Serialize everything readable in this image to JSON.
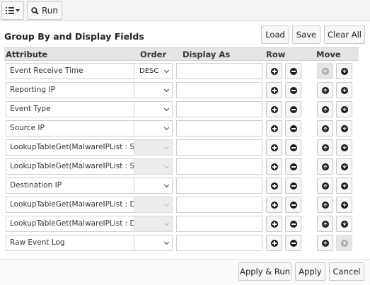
{
  "toolbar": {
    "menu_icon": "list-icon",
    "run_icon": "search-icon",
    "run_label": "Run"
  },
  "section": {
    "title": "Group By and Display Fields",
    "load_label": "Load",
    "save_label": "Save",
    "clear_all_label": "Clear All"
  },
  "table": {
    "headers": {
      "attribute": "Attribute",
      "order": "Order",
      "display_as": "Display As",
      "row": "Row",
      "move": "Move"
    },
    "rows": [
      {
        "attribute": "Event Receive Time",
        "order": "DESC",
        "order_enabled": true,
        "display_as": "",
        "move_up_enabled": false,
        "move_down_enabled": true
      },
      {
        "attribute": "Reporting IP",
        "order": "",
        "order_enabled": true,
        "display_as": "",
        "move_up_enabled": true,
        "move_down_enabled": true
      },
      {
        "attribute": "Event Type",
        "order": "",
        "order_enabled": true,
        "display_as": "",
        "move_up_enabled": true,
        "move_down_enabled": true
      },
      {
        "attribute": "Source IP",
        "order": "",
        "order_enabled": true,
        "display_as": "",
        "move_up_enabled": true,
        "move_down_enabled": true
      },
      {
        "attribute": "LookupTableGet(MalwareIPList : Sour",
        "order": "",
        "order_enabled": false,
        "display_as": "",
        "move_up_enabled": true,
        "move_down_enabled": true
      },
      {
        "attribute": "LookupTableGet(MalwareIPList : Sour",
        "order": "",
        "order_enabled": false,
        "display_as": "",
        "move_up_enabled": true,
        "move_down_enabled": true
      },
      {
        "attribute": "Destination IP",
        "order": "",
        "order_enabled": true,
        "display_as": "",
        "move_up_enabled": true,
        "move_down_enabled": true
      },
      {
        "attribute": "LookupTableGet(MalwareIPList : Dest",
        "order": "",
        "order_enabled": false,
        "display_as": "",
        "move_up_enabled": true,
        "move_down_enabled": true
      },
      {
        "attribute": "LookupTableGet(MalwareIPList : Dest",
        "order": "",
        "order_enabled": false,
        "display_as": "",
        "move_up_enabled": true,
        "move_down_enabled": true
      },
      {
        "attribute": "Raw Event Log",
        "order": "",
        "order_enabled": true,
        "display_as": "",
        "move_up_enabled": true,
        "move_down_enabled": false
      }
    ]
  },
  "footer": {
    "apply_run_label": "Apply & Run",
    "apply_label": "Apply",
    "cancel_label": "Cancel"
  },
  "icons": {
    "add_row": "plus-circle-icon",
    "remove_row": "minus-circle-icon",
    "move_up": "arrow-up-circle-icon",
    "move_down": "arrow-down-circle-icon",
    "order_dropdown": "chevron-down-icon"
  }
}
